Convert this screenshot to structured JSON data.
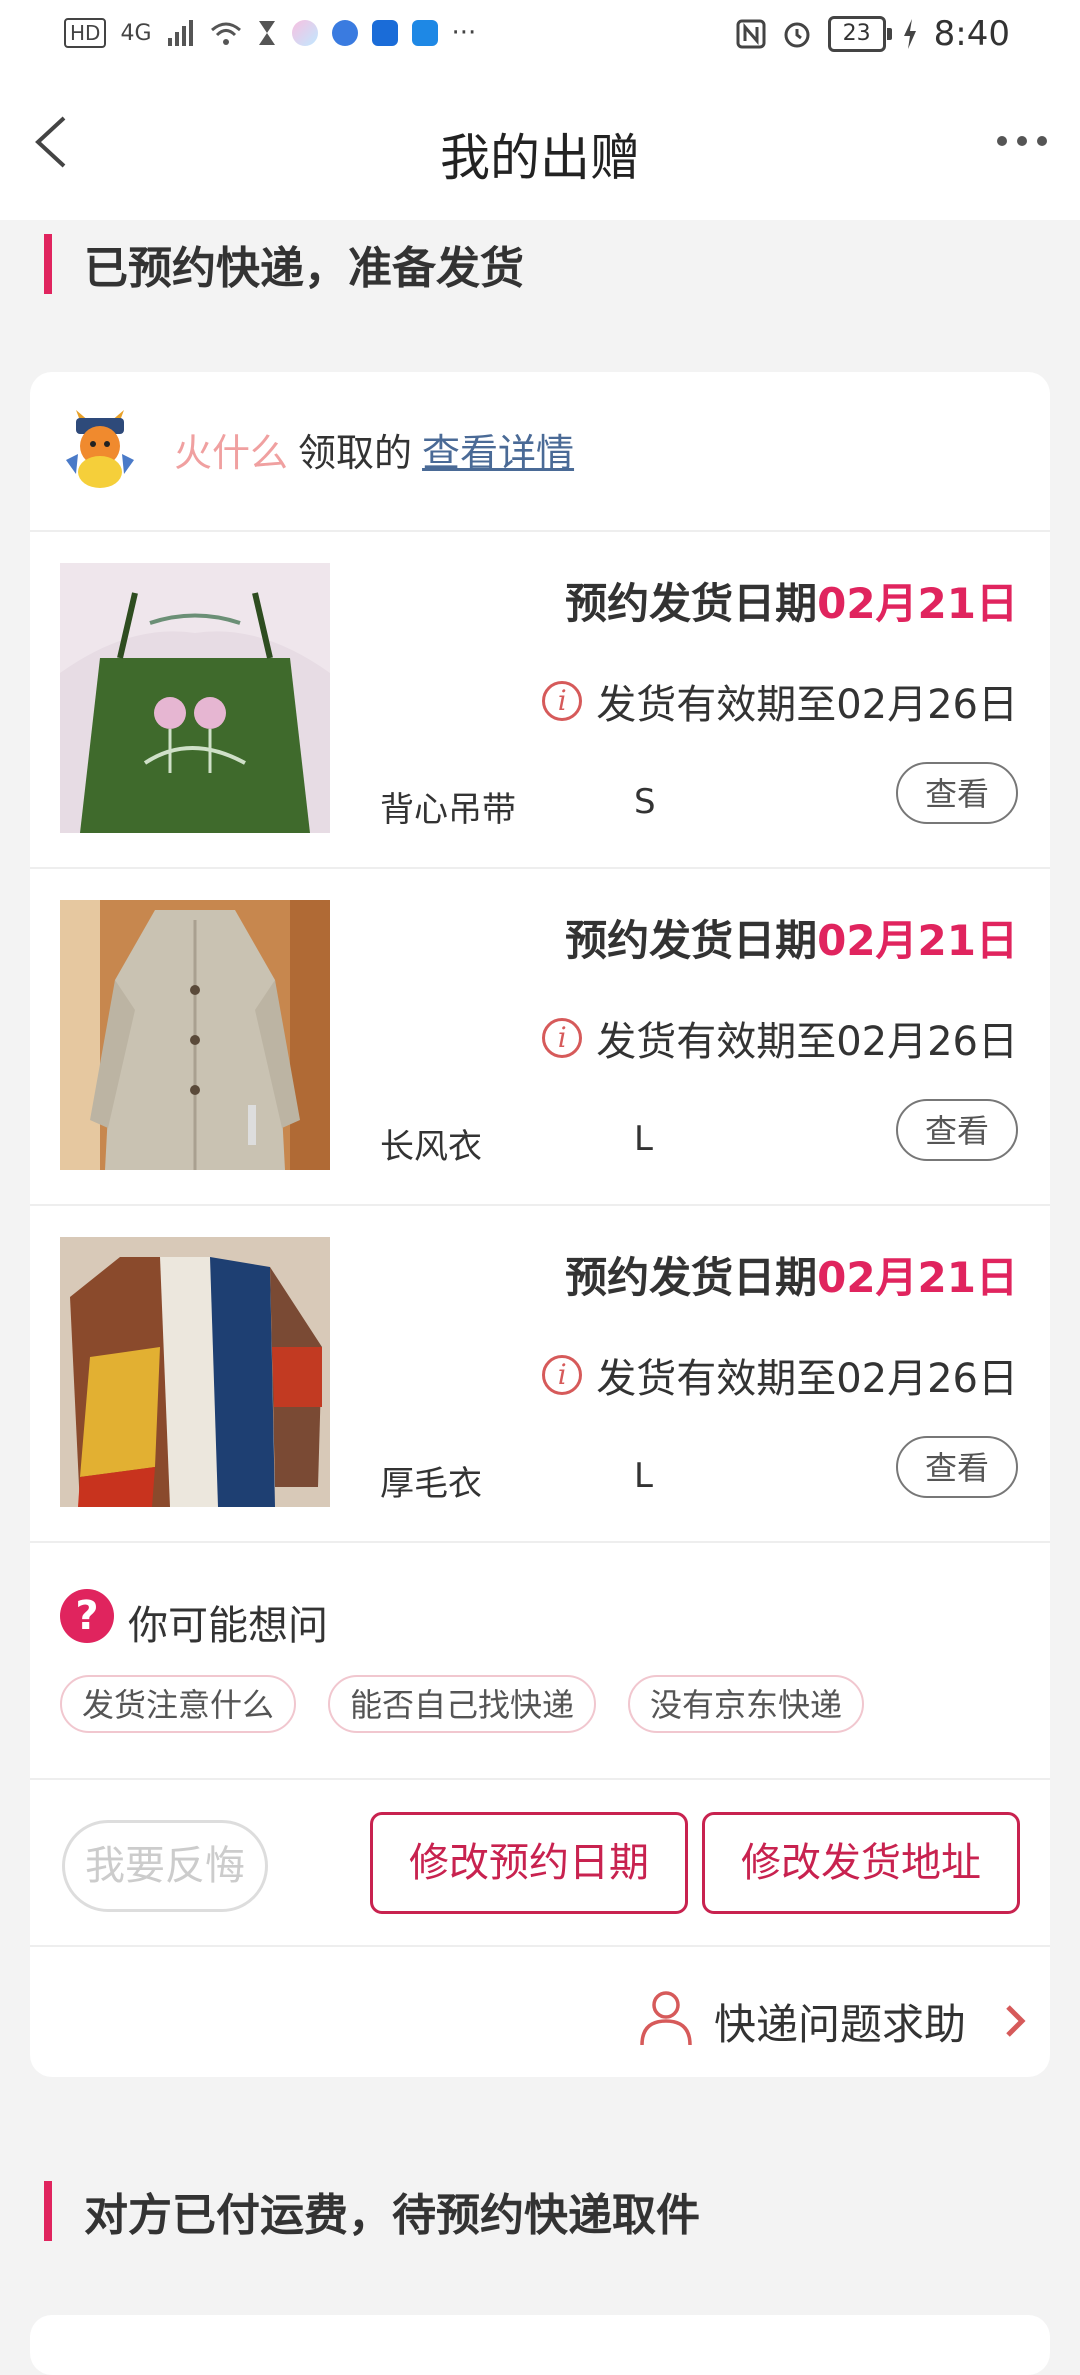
{
  "status": {
    "time": "8:40",
    "battery": "23",
    "network": "4G",
    "hd": "HD"
  },
  "header": {
    "title": "我的出赠"
  },
  "sections": [
    {
      "title": "已预约快递，准备发货"
    },
    {
      "title": "对方已付运费，待预约快递取件"
    }
  ],
  "card": {
    "receiver_name": "火什么",
    "receiver_verb": "领取的",
    "details_link": "查看详情",
    "items": [
      {
        "appt_label": "预约发货日期",
        "appt_date": "02月21日",
        "valid_text": "发货有效期至02月26日",
        "name": "背心吊带",
        "size": "S",
        "view_label": "查看",
        "thumb": "green-slip-dress"
      },
      {
        "appt_label": "预约发货日期",
        "appt_date": "02月21日",
        "valid_text": "发货有效期至02月26日",
        "name": "长风衣",
        "size": "L",
        "view_label": "查看",
        "thumb": "beige-trench-coat"
      },
      {
        "appt_label": "预约发货日期",
        "appt_date": "02月21日",
        "valid_text": "发货有效期至02月26日",
        "name": "厚毛衣",
        "size": "L",
        "view_label": "查看",
        "thumb": "color-block-sweater"
      }
    ],
    "faq": {
      "title": "你可能想问",
      "chips": [
        "发货注意什么",
        "能否自己找快递",
        "没有京东快递"
      ]
    },
    "actions": {
      "regret": "我要反悔",
      "modify_date": "修改预约日期",
      "modify_address": "修改发货地址"
    },
    "help": {
      "label": "快递问题求助"
    }
  },
  "colors": {
    "accent": "#e0245e",
    "link": "#4a6a96",
    "receiver": "#f0a0a0"
  }
}
